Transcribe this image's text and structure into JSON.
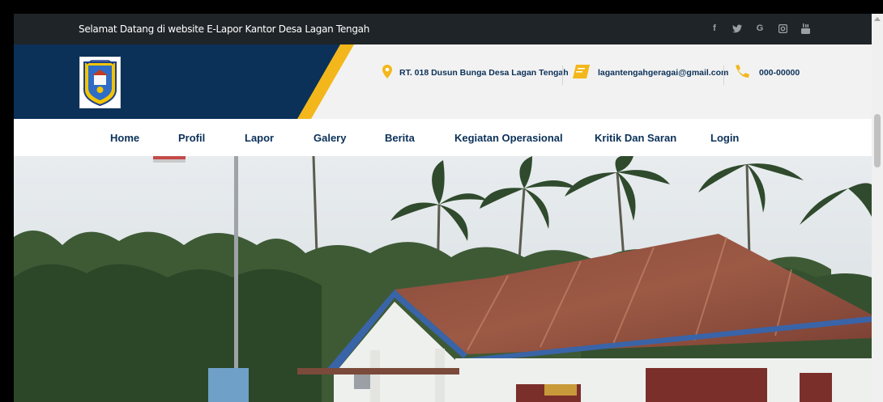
{
  "topbar": {
    "welcome": "Selamat Datang di website E-Lapor Kantor Desa Lagan Tengah",
    "social_icons": [
      "facebook-icon",
      "twitter-icon",
      "google-icon",
      "instagram-icon",
      "youtube-icon"
    ]
  },
  "header": {
    "logo": "desa-emblem",
    "address": "RT. 018 Dusun Bunga Desa Lagan Tengah",
    "email": "lagantengahgeragai@gmail.com",
    "phone": "000-00000"
  },
  "nav": {
    "items": [
      "Home",
      "Profil",
      "Lapor",
      "Galery",
      "Berita",
      "Kegiatan Operasional",
      "Kritik Dan Saran",
      "Login"
    ]
  },
  "colors": {
    "navy": "#0b3159",
    "accent": "#f3b71b",
    "topbar": "#1f2428"
  }
}
